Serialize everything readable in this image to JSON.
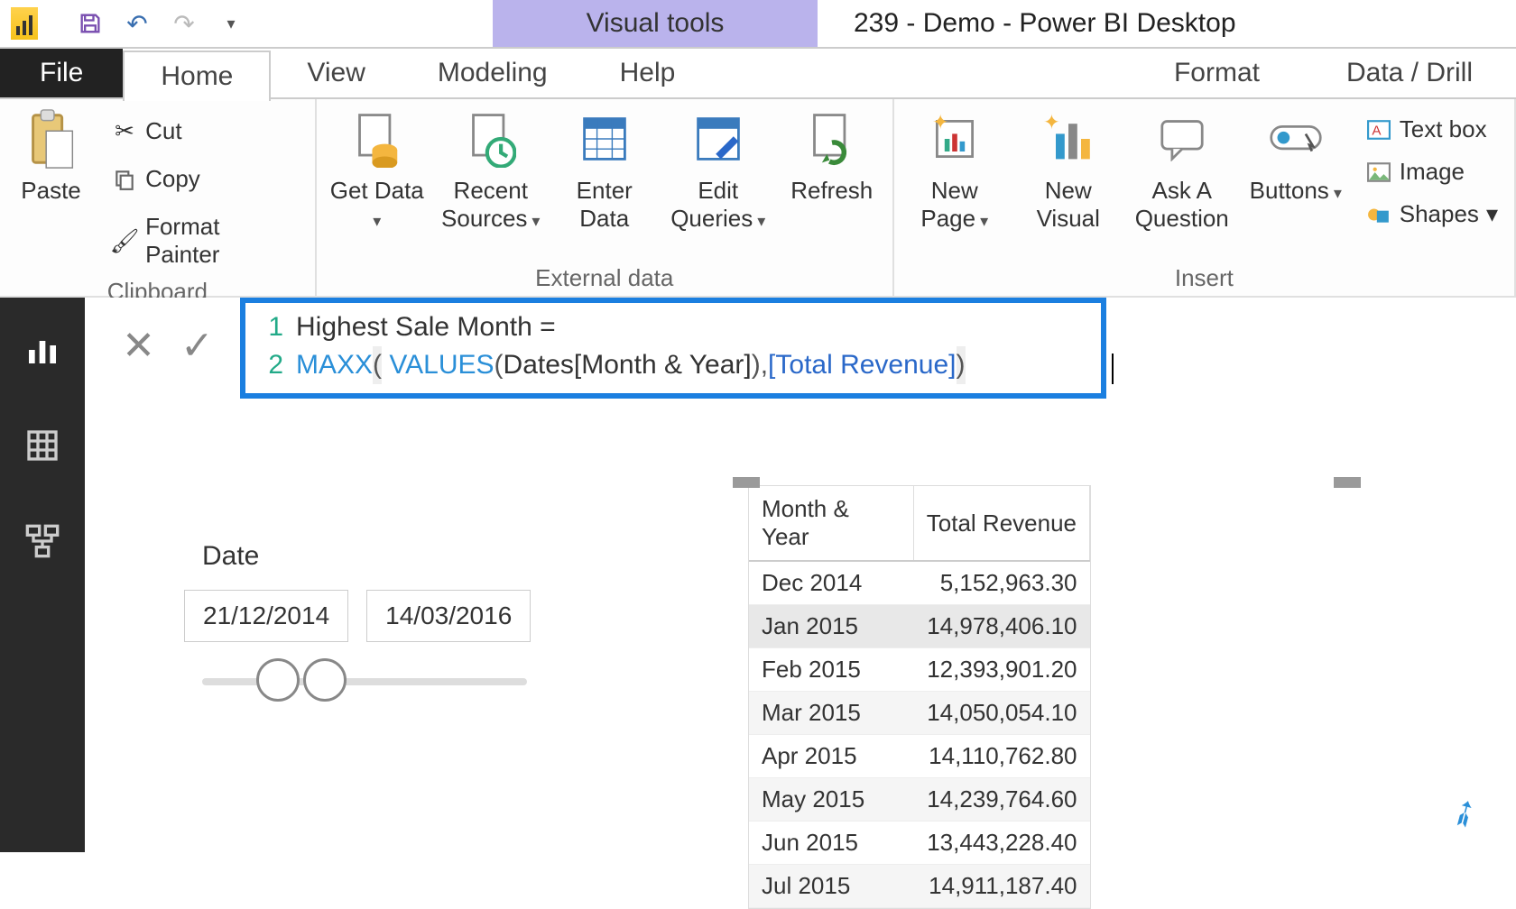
{
  "title": {
    "context_tab": "Visual tools",
    "document": "239 - Demo - Power BI Desktop"
  },
  "tabs": {
    "file": "File",
    "home": "Home",
    "view": "View",
    "modeling": "Modeling",
    "help": "Help",
    "format": "Format",
    "data_drill": "Data / Drill"
  },
  "ribbon": {
    "clipboard": {
      "paste": "Paste",
      "cut": "Cut",
      "copy": "Copy",
      "format_painter": "Format Painter",
      "label": "Clipboard"
    },
    "external": {
      "get_data": "Get Data",
      "recent": "Recent Sources",
      "enter": "Enter Data",
      "edit_q": "Edit Queries",
      "refresh": "Refresh",
      "label": "External data"
    },
    "insert": {
      "new_page": "New Page",
      "new_visual": "New Visual",
      "ask": "Ask A Question",
      "buttons": "Buttons",
      "textbox": "Text box",
      "image": "Image",
      "shapes": "Shapes",
      "label": "Insert"
    }
  },
  "formula": {
    "line1": "Highest Sale Month =",
    "line2_fn1": "MAXX",
    "line2_p1": "(",
    "line2_fn2": "VALUES",
    "line2_p2": "( ",
    "line2_col": "Dates[Month & Year]",
    "line2_p3": " ), ",
    "line2_meas": "[Total Revenue]",
    "line2_p4": " )"
  },
  "slicer": {
    "title": "Date",
    "from": "21/12/2014",
    "to": "14/03/2016"
  },
  "table": {
    "col1": "Month & Year",
    "col2": "Total Revenue",
    "rows": [
      {
        "m": "Dec 2014",
        "v": "5,152,963.30"
      },
      {
        "m": "Jan 2015",
        "v": "14,978,406.10"
      },
      {
        "m": "Feb 2015",
        "v": "12,393,901.20"
      },
      {
        "m": "Mar 2015",
        "v": "14,050,054.10"
      },
      {
        "m": "Apr 2015",
        "v": "14,110,762.80"
      },
      {
        "m": "May 2015",
        "v": "14,239,764.60"
      },
      {
        "m": "Jun 2015",
        "v": "13,443,228.40"
      },
      {
        "m": "Jul 2015",
        "v": "14,911,187.40"
      }
    ]
  }
}
